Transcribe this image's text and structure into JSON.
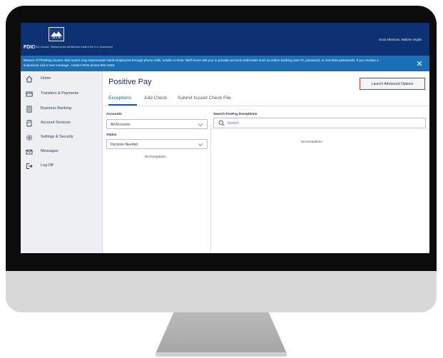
{
  "header": {
    "bank_logo_text": "MVB",
    "fdic_label": "FDIC",
    "fdic_note": "FDIC-Insured - Backed by the full faith and credit of the U.S. Government",
    "greeting": "Good Afternoon, Mallorie Virgilio"
  },
  "banner": {
    "text": "Beware of Phishing Scams: Bad actors may impersonate bank employees through phone calls, emails or texts. We'll never ask you to provide account credentials such as online banking user ID, password, or one-time passwords. If you receive a suspicious call or text message, contact MVB at 844-682-2265.",
    "close_icon": "close-icon"
  },
  "sidebar": {
    "items": [
      {
        "label": "Home",
        "icon": "home-icon"
      },
      {
        "label": "Transfers & Payments",
        "icon": "transfer-icon"
      },
      {
        "label": "Business Banking",
        "icon": "building-icon"
      },
      {
        "label": "Account Services",
        "icon": "document-icon"
      },
      {
        "label": "Settings & Security",
        "icon": "gear-icon"
      },
      {
        "label": "Messages",
        "icon": "mail-icon"
      },
      {
        "label": "Log Off",
        "icon": "logout-icon"
      }
    ]
  },
  "main": {
    "title": "Positive Pay",
    "advanced_button": "Launch Advanced Options",
    "tabs": [
      "Exceptions",
      "Add Check",
      "Submit Issued Check File"
    ],
    "accounts": {
      "label": "Accounts",
      "value": "All Accounts"
    },
    "status": {
      "label": "Status",
      "value": "Decision Needed"
    },
    "left_empty": "No Exceptions",
    "search": {
      "label": "Search PosPay Exceptions",
      "placeholder": "Search"
    },
    "right_empty": "No Exceptions"
  },
  "colors": {
    "header": "#0e3271",
    "banner": "#1a6fb5",
    "accent": "#1b5a9e",
    "highlight": "#d92727"
  }
}
